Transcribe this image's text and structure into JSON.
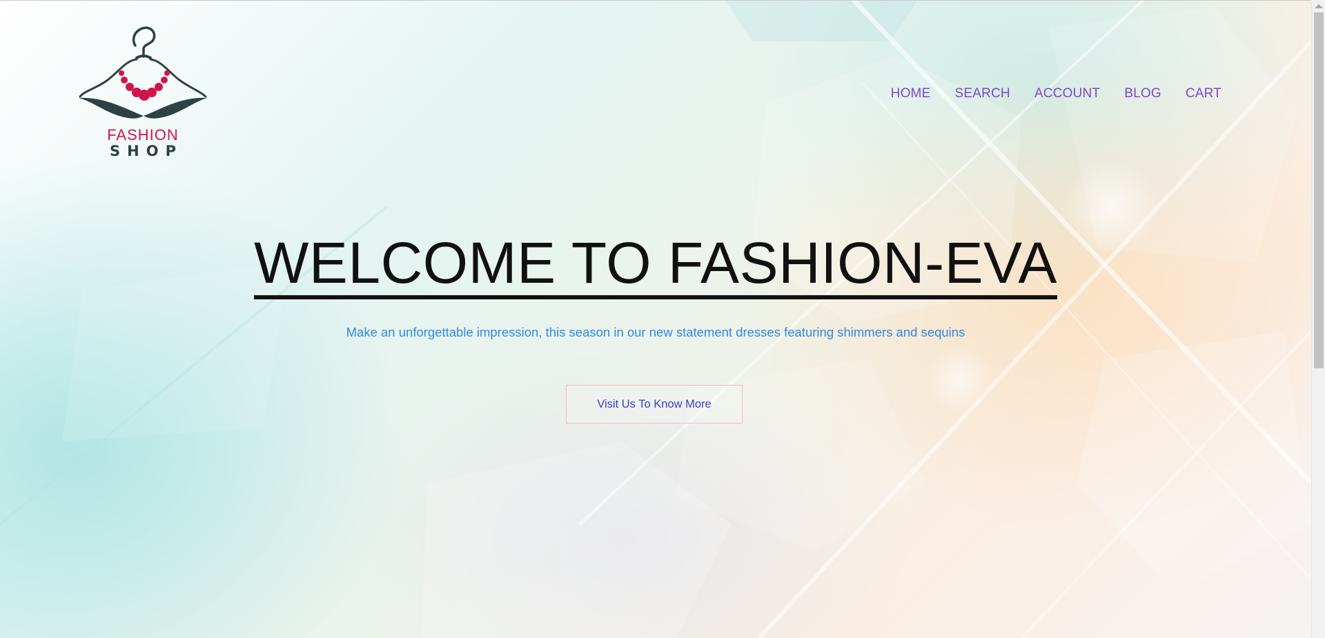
{
  "brand": {
    "line1": "FASHION",
    "line2": "SHOP",
    "colors": {
      "accent": "#d1154b",
      "dark": "#2f4143"
    }
  },
  "nav": {
    "items": [
      {
        "label": "HOME"
      },
      {
        "label": "SEARCH"
      },
      {
        "label": "ACCOUNT"
      },
      {
        "label": "BLOG"
      },
      {
        "label": "CART"
      }
    ],
    "color": "#7b47d0"
  },
  "hero": {
    "title": "WELCOME TO FASHION-EVA",
    "subtitle": "Make an unforgettable impression, this season in our new statement dresses featuring shimmers and sequins",
    "cta_label": "Visit Us To Know More"
  },
  "icons": {
    "logo": "hanger-necklace-icon",
    "scroll_up": "chevron-up-icon"
  }
}
